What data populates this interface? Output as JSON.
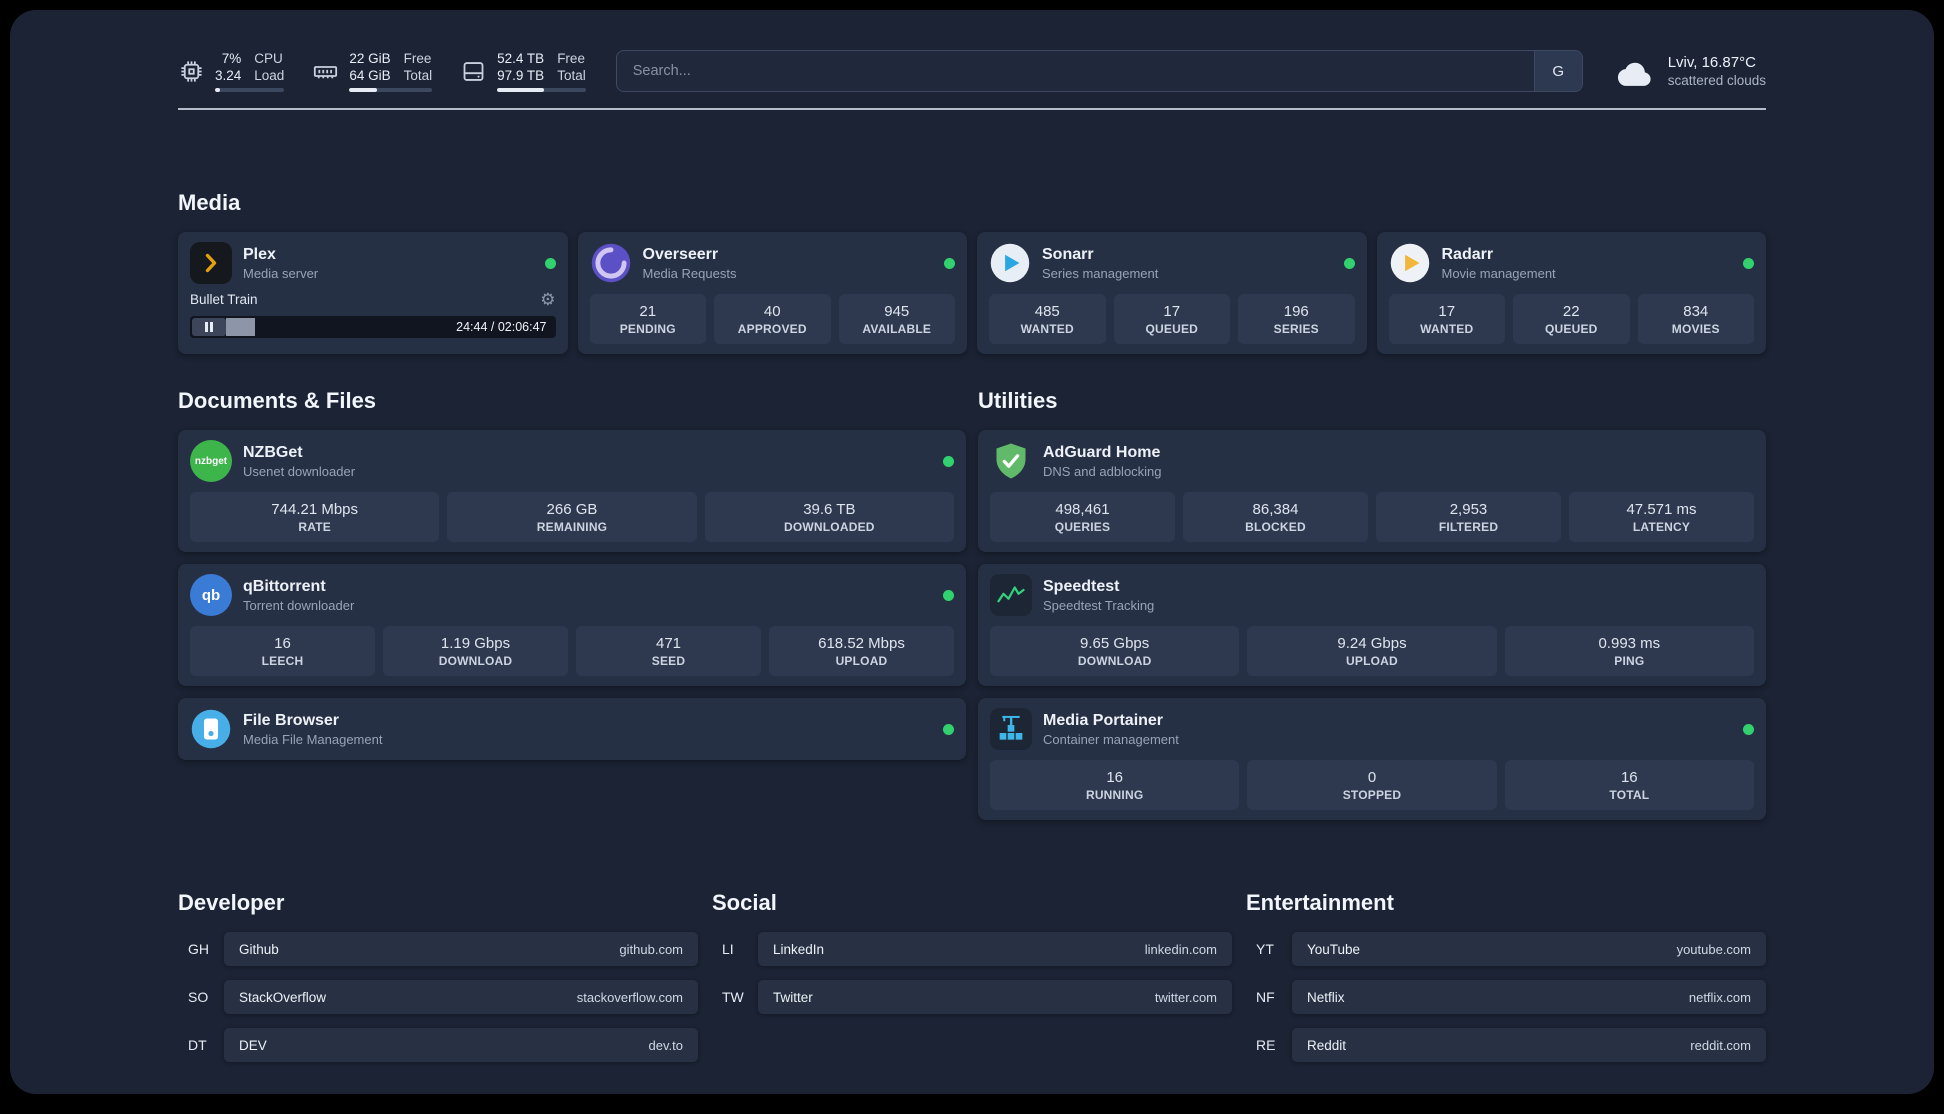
{
  "colors": {
    "background": "#1b2334",
    "card": "#263044",
    "tile": "#2e3950",
    "status_online": "#31d26d"
  },
  "topbar": {
    "metrics": [
      {
        "name": "cpu",
        "rows": [
          {
            "value": "7%",
            "label": "CPU"
          },
          {
            "value": "3.24",
            "label": "Load"
          }
        ],
        "bar_pct": 7
      },
      {
        "name": "memory",
        "rows": [
          {
            "value": "22 GiB",
            "label": "Free"
          },
          {
            "value": "64 GiB",
            "label": "Total"
          }
        ],
        "bar_pct": 34
      },
      {
        "name": "disk",
        "rows": [
          {
            "value": "52.4 TB",
            "label": "Free"
          },
          {
            "value": "97.9 TB",
            "label": "Total"
          }
        ],
        "bar_pct": 53
      }
    ],
    "search": {
      "placeholder": "Search...",
      "provider": "G"
    },
    "weather": {
      "location": "Lviv, 16.87°C",
      "condition": "scattered clouds"
    }
  },
  "sections": {
    "media": {
      "title": "Media",
      "cards": [
        {
          "name": "Plex",
          "subtitle": "Media server",
          "online": true,
          "player": {
            "track": "Bullet Train",
            "time": "24:44 / 02:06:47",
            "progress_pct": 13
          }
        },
        {
          "name": "Overseerr",
          "subtitle": "Media Requests",
          "online": true,
          "stats": [
            {
              "value": "21",
              "label": "PENDING"
            },
            {
              "value": "40",
              "label": "APPROVED"
            },
            {
              "value": "945",
              "label": "AVAILABLE"
            }
          ]
        },
        {
          "name": "Sonarr",
          "subtitle": "Series management",
          "online": true,
          "stats": [
            {
              "value": "485",
              "label": "WANTED"
            },
            {
              "value": "17",
              "label": "QUEUED"
            },
            {
              "value": "196",
              "label": "SERIES"
            }
          ]
        },
        {
          "name": "Radarr",
          "subtitle": "Movie management",
          "online": true,
          "stats": [
            {
              "value": "17",
              "label": "WANTED"
            },
            {
              "value": "22",
              "label": "QUEUED"
            },
            {
              "value": "834",
              "label": "MOVIES"
            }
          ]
        }
      ]
    },
    "documents": {
      "title": "Documents & Files",
      "cards": [
        {
          "name": "NZBGet",
          "subtitle": "Usenet downloader",
          "online": true,
          "icon_text": "nzbget",
          "stats": [
            {
              "value": "744.21 Mbps",
              "label": "RATE"
            },
            {
              "value": "266 GB",
              "label": "REMAINING"
            },
            {
              "value": "39.6 TB",
              "label": "DOWNLOADED"
            }
          ]
        },
        {
          "name": "qBittorrent",
          "subtitle": "Torrent downloader",
          "online": true,
          "icon_text": "qb",
          "stats": [
            {
              "value": "16",
              "label": "LEECH"
            },
            {
              "value": "1.19 Gbps",
              "label": "DOWNLOAD"
            },
            {
              "value": "471",
              "label": "SEED"
            },
            {
              "value": "618.52 Mbps",
              "label": "UPLOAD"
            }
          ]
        },
        {
          "name": "File Browser",
          "subtitle": "Media File Management",
          "online": true
        }
      ]
    },
    "utilities": {
      "title": "Utilities",
      "cards": [
        {
          "name": "AdGuard Home",
          "subtitle": "DNS and adblocking",
          "online": false,
          "stats": [
            {
              "value": "498,461",
              "label": "QUERIES"
            },
            {
              "value": "86,384",
              "label": "BLOCKED"
            },
            {
              "value": "2,953",
              "label": "FILTERED"
            },
            {
              "value": "47.571 ms",
              "label": "LATENCY"
            }
          ]
        },
        {
          "name": "Speedtest",
          "subtitle": "Speedtest Tracking",
          "online": false,
          "stats": [
            {
              "value": "9.65 Gbps",
              "label": "DOWNLOAD"
            },
            {
              "value": "9.24 Gbps",
              "label": "UPLOAD"
            },
            {
              "value": "0.993 ms",
              "label": "PING"
            }
          ]
        },
        {
          "name": "Media Portainer",
          "subtitle": "Container management",
          "online": true,
          "stats": [
            {
              "value": "16",
              "label": "RUNNING"
            },
            {
              "value": "0",
              "label": "STOPPED"
            },
            {
              "value": "16",
              "label": "TOTAL"
            }
          ]
        }
      ]
    }
  },
  "bookmarks": [
    {
      "title": "Developer",
      "items": [
        {
          "abbr": "GH",
          "name": "Github",
          "url": "github.com"
        },
        {
          "abbr": "SO",
          "name": "StackOverflow",
          "url": "stackoverflow.com"
        },
        {
          "abbr": "DT",
          "name": "DEV",
          "url": "dev.to"
        }
      ]
    },
    {
      "title": "Social",
      "items": [
        {
          "abbr": "LI",
          "name": "LinkedIn",
          "url": "linkedin.com"
        },
        {
          "abbr": "TW",
          "name": "Twitter",
          "url": "twitter.com"
        }
      ]
    },
    {
      "title": "Entertainment",
      "items": [
        {
          "abbr": "YT",
          "name": "YouTube",
          "url": "youtube.com"
        },
        {
          "abbr": "NF",
          "name": "Netflix",
          "url": "netflix.com"
        },
        {
          "abbr": "RE",
          "name": "Reddit",
          "url": "reddit.com"
        }
      ]
    }
  ]
}
